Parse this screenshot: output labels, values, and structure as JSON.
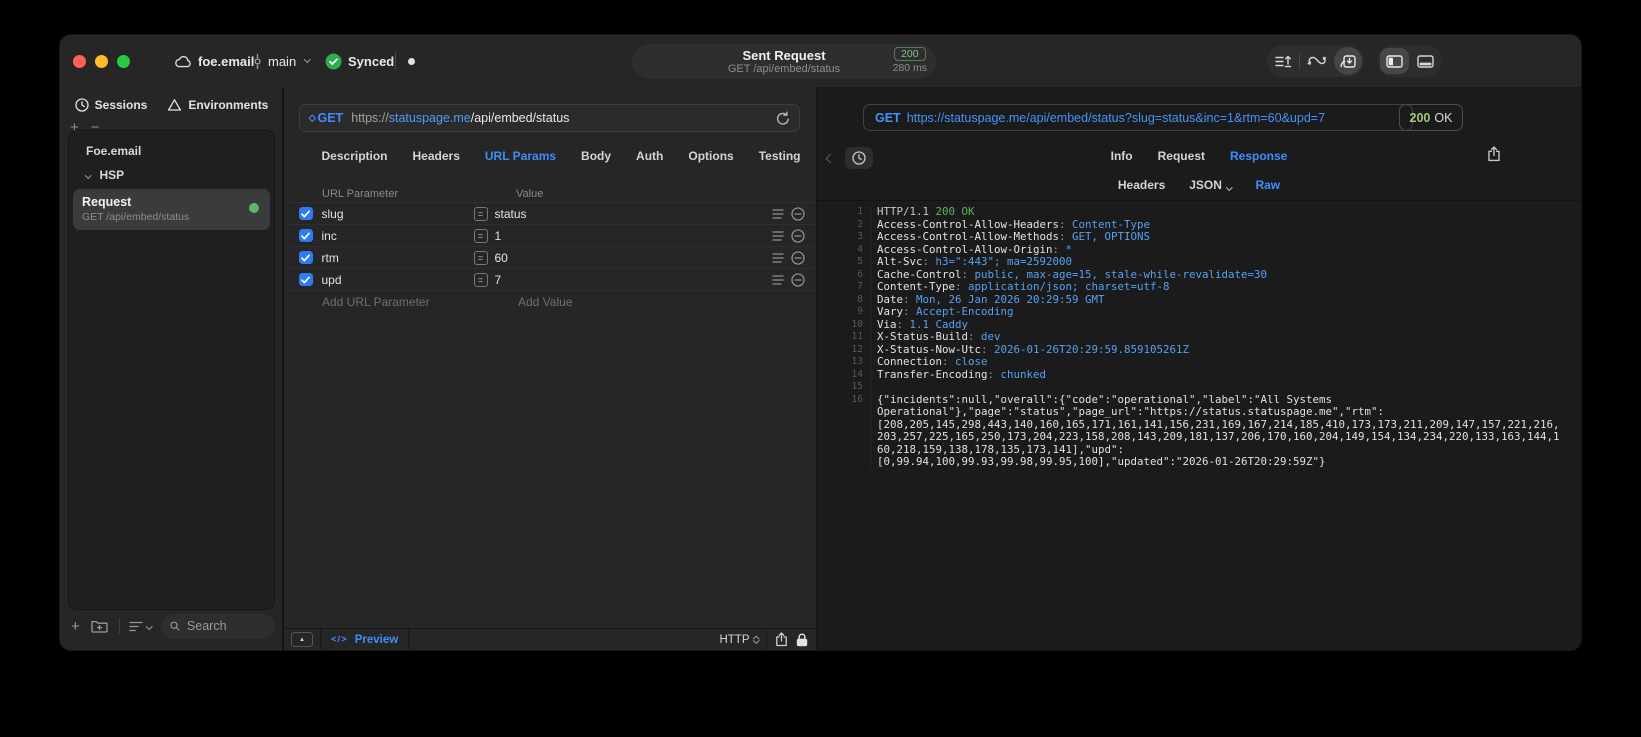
{
  "colors": {
    "accent": "#3f8cff",
    "value_blue": "#55a1f2",
    "status_green": "#57b75f",
    "badge_green": "#7ec97e",
    "checkbox_blue": "#2f7bf6"
  },
  "titlebar": {
    "project": "foe.email",
    "branch": "main",
    "sync_label": "Synced",
    "request_title": "Sent Request",
    "request_subtitle": "GET /api/embed/status",
    "status_code": "200",
    "duration": "280 ms"
  },
  "sidebar": {
    "tabs": [
      {
        "label": "Sessions"
      },
      {
        "label": "Environments"
      }
    ],
    "tree": {
      "group_collapsed": "Foe.email",
      "group_expanded": "HSP",
      "request_name": "Request",
      "request_detail": "GET /api/embed/status"
    },
    "search_placeholder": "Search"
  },
  "editor": {
    "method": "GET",
    "url_scheme": "https://",
    "url_host": "statuspage.me",
    "url_path": "/api/embed/status",
    "tabs": [
      "Description",
      "Headers",
      "URL Params",
      "Body",
      "Auth",
      "Options",
      "Testing"
    ],
    "active_tab": "URL Params",
    "table": {
      "col_param": "URL Parameter",
      "col_value": "Value",
      "assign_glyph": "=",
      "rows": [
        {
          "name": "slug",
          "value": "status",
          "checked": true
        },
        {
          "name": "inc",
          "value": "1",
          "checked": true
        },
        {
          "name": "rtm",
          "value": "60",
          "checked": true
        },
        {
          "name": "upd",
          "value": "7",
          "checked": true
        }
      ],
      "add_param": "Add URL Parameter",
      "add_value": "Add Value"
    },
    "footer": {
      "collapse_glyph": "▲",
      "code_glyph": "</>",
      "preview": "Preview",
      "protocol": "HTTP"
    }
  },
  "response": {
    "method": "GET",
    "url": "https://statuspage.me/api/embed/status?slug=status&inc=1&rtm=60&upd=7",
    "status_code": "200",
    "status_text": "OK",
    "tabs": [
      "Info",
      "Request",
      "Response"
    ],
    "active_tab": "Response",
    "subtabs": [
      "Headers",
      "JSON",
      "Raw"
    ],
    "active_subtab": "Raw",
    "dropdown_subtab": "JSON",
    "code": {
      "status_line": {
        "protocol": "HTTP/1.1",
        "status": "200 OK"
      },
      "headers": [
        [
          "Access-Control-Allow-Headers",
          "Content-Type"
        ],
        [
          "Access-Control-Allow-Methods",
          "GET, OPTIONS"
        ],
        [
          "Access-Control-Allow-Origin",
          "*"
        ],
        [
          "Alt-Svc",
          "h3=\":443\"; ma=2592000"
        ],
        [
          "Cache-Control",
          "public, max-age=15, stale-while-revalidate=30"
        ],
        [
          "Content-Type",
          "application/json; charset=utf-8"
        ],
        [
          "Date",
          "Mon, 26 Jan 2026 20:29:59 GMT"
        ],
        [
          "Vary",
          "Accept-Encoding"
        ],
        [
          "Via",
          "1.1 Caddy"
        ],
        [
          "X-Status-Build",
          "dev"
        ],
        [
          "X-Status-Now-Utc",
          "2026-01-26T20:29:59.859105261Z"
        ],
        [
          "Connection",
          "close"
        ],
        [
          "Transfer-Encoding",
          "chunked"
        ]
      ],
      "body_lines": [
        "{\"incidents\":null,\"overall\":{\"code\":\"operational\",\"label\":\"All Systems",
        "Operational\"},\"page\":\"status\",\"page_url\":\"https://status.statuspage.me\",\"rtm\":",
        "[208,205,145,298,443,140,160,165,171,161,141,156,231,169,167,214,185,410,173,173,211,209,147,157,221,216,",
        "203,257,225,165,250,173,204,223,158,208,143,209,181,137,206,170,160,204,149,154,134,234,220,133,163,144,1",
        "60,218,159,138,178,135,173,141],\"upd\":",
        "[0,99.94,100,99.93,99.98,99.95,100],\"updated\":\"2026-01-26T20:29:59Z\"}"
      ]
    }
  }
}
